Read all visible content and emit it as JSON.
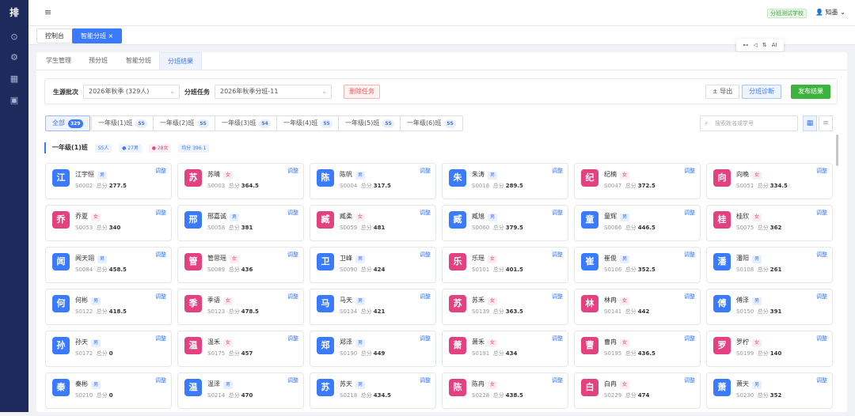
{
  "app": {
    "logo": "排"
  },
  "sidebar": {
    "icons": [
      {
        "name": "dashboard-icon",
        "glyph": "⊙"
      },
      {
        "name": "settings-icon",
        "glyph": "⚙"
      },
      {
        "name": "building-icon",
        "glyph": "▦"
      },
      {
        "name": "calendar-icon",
        "glyph": "▣"
      }
    ]
  },
  "header": {
    "menu_glyph": "≡",
    "school": "分班测试学校",
    "user": "知墨"
  },
  "page_tabs": [
    {
      "label": "控制台",
      "active": false
    },
    {
      "label": "智能分班",
      "active": true
    }
  ],
  "float_tools": [
    "⊷",
    "◁",
    "⇅",
    "AI"
  ],
  "sub_tabs": [
    {
      "label": "学生管理",
      "active": false
    },
    {
      "label": "预分班",
      "active": false
    },
    {
      "label": "智能分班",
      "active": false
    },
    {
      "label": "分班结果",
      "active": true
    }
  ],
  "filter": {
    "batch_label": "生源批次",
    "batch_value": "2026年秋季 (329人)",
    "task_label": "分班任务",
    "task_value": "2026年秋季分班-11",
    "delete_label": "删除任务",
    "export_label": "± 导出",
    "diagnose_label": "分班诊断",
    "publish_label": "发布结果"
  },
  "class_tabs": [
    {
      "label": "全部",
      "count": "329",
      "active": true
    },
    {
      "label": "一年级(1)班",
      "count": "55",
      "active": false
    },
    {
      "label": "一年级(2)班",
      "count": "55",
      "active": false
    },
    {
      "label": "一年级(3)班",
      "count": "54",
      "active": false
    },
    {
      "label": "一年级(4)班",
      "count": "55",
      "active": false
    },
    {
      "label": "一年级(5)班",
      "count": "55",
      "active": false
    },
    {
      "label": "一年级(6)班",
      "count": "55",
      "active": false
    }
  ],
  "search": {
    "placeholder": "搜索姓名或学号"
  },
  "class_group": {
    "title": "一年级(1)班",
    "total": "55人",
    "male": "● 27男",
    "female": "● 28女",
    "avg": "均分 396.1"
  },
  "labels": {
    "adjust": "调整",
    "score": "总分",
    "male": "男",
    "female": "女"
  },
  "colors": {
    "blue": "#3a7afe",
    "pink": "#e3417f"
  },
  "students": [
    {
      "name": "江宇恒",
      "initial": "江",
      "gender": "男",
      "id": "S0002",
      "score": "277.5"
    },
    {
      "name": "苏晴",
      "initial": "苏",
      "gender": "女",
      "id": "S0003",
      "score": "364.5"
    },
    {
      "name": "陈帆",
      "initial": "陈",
      "gender": "男",
      "id": "S0004",
      "score": "317.5"
    },
    {
      "name": "朱涛",
      "initial": "朱",
      "gender": "男",
      "id": "S0018",
      "score": "289.5"
    },
    {
      "name": "纪楠",
      "initial": "纪",
      "gender": "女",
      "id": "S0047",
      "score": "372.5"
    },
    {
      "name": "向晚",
      "initial": "向",
      "gender": "女",
      "id": "S0051",
      "score": "334.5"
    },
    {
      "name": "乔夏",
      "initial": "乔",
      "gender": "女",
      "id": "S0053",
      "score": "340"
    },
    {
      "name": "邢嘉诚",
      "initial": "邢",
      "gender": "男",
      "id": "S0058",
      "score": "381"
    },
    {
      "name": "臧柔",
      "initial": "臧",
      "gender": "女",
      "id": "S0059",
      "score": "481"
    },
    {
      "name": "臧旭",
      "initial": "臧",
      "gender": "男",
      "id": "S0060",
      "score": "379.5"
    },
    {
      "name": "童辉",
      "initial": "童",
      "gender": "男",
      "id": "S0066",
      "score": "446.5"
    },
    {
      "name": "桂欣",
      "initial": "桂",
      "gender": "女",
      "id": "S0075",
      "score": "362"
    },
    {
      "name": "闻天翊",
      "initial": "闻",
      "gender": "男",
      "id": "S0084",
      "score": "458.5"
    },
    {
      "name": "管思瑶",
      "initial": "管",
      "gender": "女",
      "id": "S0089",
      "score": "436"
    },
    {
      "name": "卫峰",
      "initial": "卫",
      "gender": "男",
      "id": "S0090",
      "score": "424"
    },
    {
      "name": "乐瑶",
      "initial": "乐",
      "gender": "女",
      "id": "S0101",
      "score": "401.5"
    },
    {
      "name": "崔俊",
      "initial": "崔",
      "gender": "男",
      "id": "S0106",
      "score": "352.5"
    },
    {
      "name": "潘阳",
      "initial": "潘",
      "gender": "男",
      "id": "S0108",
      "score": "261"
    },
    {
      "name": "何彬",
      "initial": "何",
      "gender": "男",
      "id": "S0122",
      "score": "418.5"
    },
    {
      "name": "季语",
      "initial": "季",
      "gender": "女",
      "id": "S0123",
      "score": "478.5"
    },
    {
      "name": "马天",
      "initial": "马",
      "gender": "男",
      "id": "S0134",
      "score": "421"
    },
    {
      "name": "苏禾",
      "initial": "苏",
      "gender": "女",
      "id": "S0139",
      "score": "363.5"
    },
    {
      "name": "林冉",
      "initial": "林",
      "gender": "女",
      "id": "S0141",
      "score": "442"
    },
    {
      "name": "傅泽",
      "initial": "傅",
      "gender": "男",
      "id": "S0150",
      "score": "391"
    },
    {
      "name": "孙天",
      "initial": "孙",
      "gender": "男",
      "id": "S0172",
      "score": "0"
    },
    {
      "name": "温禾",
      "initial": "温",
      "gender": "女",
      "id": "S0175",
      "score": "457"
    },
    {
      "name": "郑泽",
      "initial": "郑",
      "gender": "男",
      "id": "S0190",
      "score": "449"
    },
    {
      "name": "萧禾",
      "initial": "萧",
      "gender": "女",
      "id": "S0191",
      "score": "434"
    },
    {
      "name": "曹冉",
      "initial": "曹",
      "gender": "女",
      "id": "S0195",
      "score": "436.5"
    },
    {
      "name": "罗柠",
      "initial": "罗",
      "gender": "女",
      "id": "S0199",
      "score": "140"
    },
    {
      "name": "秦彬",
      "initial": "秦",
      "gender": "男",
      "id": "S0210",
      "score": "0"
    },
    {
      "name": "温泽",
      "initial": "温",
      "gender": "男",
      "id": "S0214",
      "score": "470"
    },
    {
      "name": "苏天",
      "initial": "苏",
      "gender": "男",
      "id": "S0218",
      "score": "434.5"
    },
    {
      "name": "陈冉",
      "initial": "陈",
      "gender": "女",
      "id": "S0228",
      "score": "438.5"
    },
    {
      "name": "白冉",
      "initial": "白",
      "gender": "女",
      "id": "S0229",
      "score": "474"
    },
    {
      "name": "萧天",
      "initial": "萧",
      "gender": "男",
      "id": "S0230",
      "score": "352"
    }
  ]
}
